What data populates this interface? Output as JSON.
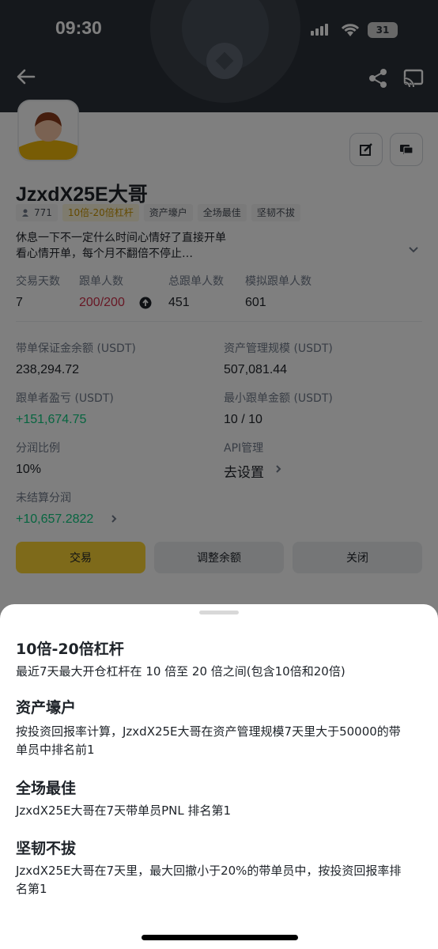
{
  "status_bar": {
    "time": "09:30",
    "battery": "31"
  },
  "profile": {
    "name": "JzxdX25E大哥",
    "followers": "771",
    "tags": [
      "10倍-20倍杠杆",
      "资产壕户",
      "全场最佳",
      "坚韧不拔"
    ],
    "bio_line1": "休息一下不一定什么时间心情好了直接开单",
    "bio_line2": "看心情开单，每个月不翻倍不停止…"
  },
  "stats": [
    {
      "label": "交易天数",
      "value": "7"
    },
    {
      "label": "跟单人数",
      "value": "200/200"
    },
    {
      "label": "总跟单人数",
      "value": "451"
    },
    {
      "label": "模拟跟单人数",
      "value": "601"
    }
  ],
  "details": {
    "margin_label": "带单保证金余额 (USDT)",
    "margin_value": "238,294.72",
    "aum_label": "资产管理规模 (USDT)",
    "aum_value": "507,081.44",
    "pnl_label": "跟单者盈亏 (USDT)",
    "pnl_value": "+151,674.75",
    "min_label": "最小跟单金额 (USDT)",
    "min_value": "10 / 10",
    "share_label": "分润比例",
    "share_value": "10%",
    "api_label": "API管理",
    "api_value": "去设置",
    "unsettled_label": "未结算分润",
    "unsettled_value": "+10,657.2822"
  },
  "buttons": {
    "trade": "交易",
    "adjust": "调整余额",
    "close": "关闭"
  },
  "sheet": {
    "items": [
      {
        "title": "10倍-20倍杠杆",
        "desc": "最近7天最大开仓杠杆在 10 倍至 20 倍之间(包含10倍和20倍)"
      },
      {
        "title": "资产壕户",
        "desc": "按投资回报率计算，JzxdX25E大哥在资产管理规模7天里大于50000的带单员中排名前1"
      },
      {
        "title": "全场最佳",
        "desc": "JzxdX25E大哥在7天带单员PNL 排名第1"
      },
      {
        "title": "坚韧不拔",
        "desc": "JzxdX25E大哥在7天里，最大回撤小于20%的带单员中，按投资回报率排名第1"
      }
    ]
  },
  "colors": {
    "accent": "#fcd535",
    "green": "#0ecb81",
    "red": "#cf304a",
    "header": "#2b3139"
  },
  "icons": [
    "back-arrow-icon",
    "share-icon",
    "cast-icon",
    "edit-icon",
    "chat-icon",
    "users-icon",
    "chevron-down-icon",
    "info-icon",
    "chevron-right-icon"
  ]
}
